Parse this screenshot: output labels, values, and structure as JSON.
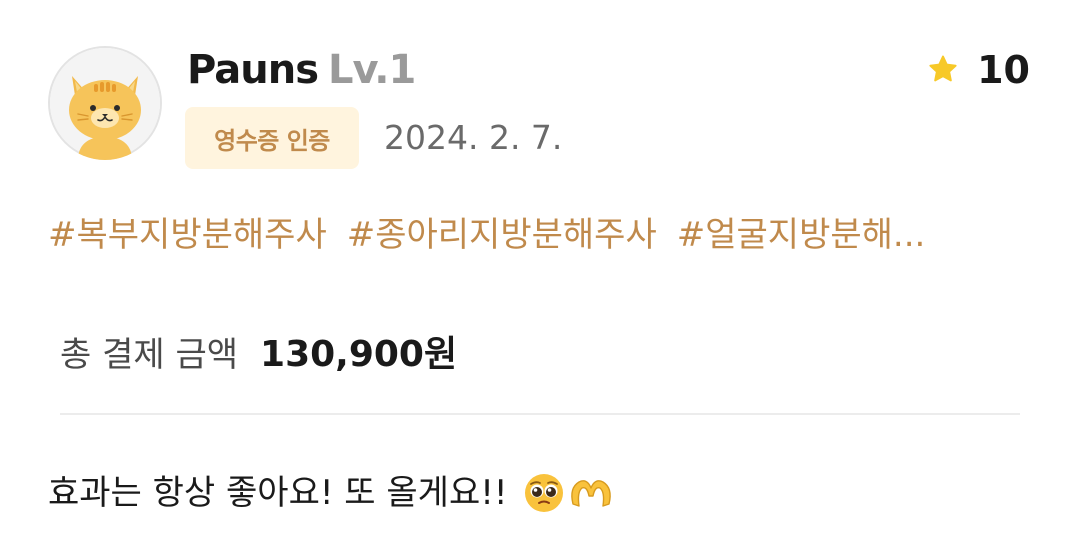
{
  "review": {
    "avatar_icon": "cat-avatar-icon",
    "username": "Pauns",
    "level": "Lv.1",
    "rating_icon": "star-icon",
    "rating": "10",
    "badge": "영수증 인증",
    "date": "2024. 2. 7.",
    "tags": [
      "#복부지방분해주사",
      "#종아리지방분해주사",
      "#얼굴지방분해..."
    ],
    "payment_label": "총 결제 금액",
    "payment_amount": "130,900원",
    "text": "효과는 항상 좋아요! 또 올게요!!",
    "emojis": [
      "pleading-face-icon",
      "heart-hands-icon"
    ]
  },
  "colors": {
    "accent": "#c08a4c",
    "badge_bg": "#fff4de",
    "star": "#f7c928",
    "level": "#9a9a9a",
    "date": "#6a6a6a"
  }
}
